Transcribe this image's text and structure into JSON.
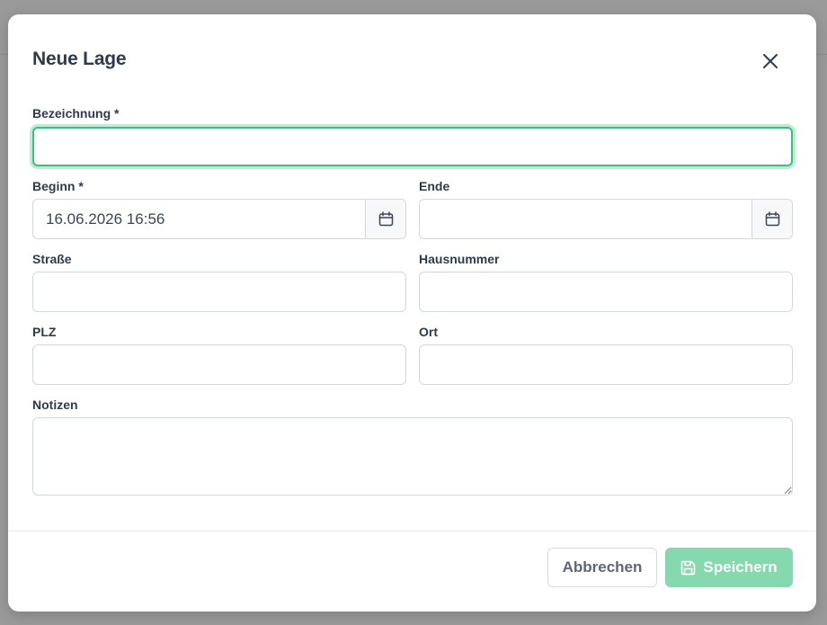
{
  "modal": {
    "title": "Neue Lage",
    "close_icon": "close-icon"
  },
  "fields": {
    "bezeichnung": {
      "label": "Bezeichnung *",
      "value": "",
      "placeholder": ""
    },
    "beginn": {
      "label": "Beginn *",
      "value": "16.06.2026 16:56",
      "icon": "calendar-icon"
    },
    "ende": {
      "label": "Ende",
      "value": "",
      "icon": "calendar-icon"
    },
    "strasse": {
      "label": "Straße",
      "value": ""
    },
    "hausnummer": {
      "label": "Hausnummer",
      "value": ""
    },
    "plz": {
      "label": "PLZ",
      "value": ""
    },
    "ort": {
      "label": "Ort",
      "value": ""
    },
    "notizen": {
      "label": "Notizen",
      "value": ""
    }
  },
  "footer": {
    "cancel_label": "Abbrechen",
    "save_label": "Speichern",
    "save_icon": "save-icon"
  },
  "colors": {
    "accent": "#3dbf7f",
    "save_button": "#86d8af",
    "text": "#2f3b4c"
  }
}
